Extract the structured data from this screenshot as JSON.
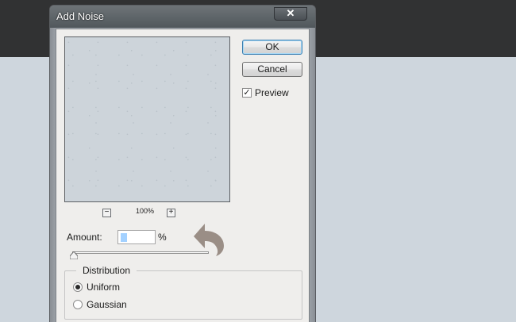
{
  "dialog": {
    "title": "Add Noise",
    "close_glyph": "✕",
    "ok_label": "OK",
    "cancel_label": "Cancel",
    "preview_label": "Preview",
    "preview_checked": true,
    "zoom_level": "100%",
    "zoom_out_glyph": "−",
    "zoom_in_glyph": "+",
    "amount_label": "Amount:",
    "amount_unit": "%",
    "amount_slider_position": 0,
    "distribution": {
      "title": "Distribution",
      "options": [
        "Uniform",
        "Gaussian"
      ],
      "selected": "Uniform"
    }
  },
  "overlay": {
    "icon": "undo-arrow-icon",
    "color": "#9a8e86"
  },
  "colors": {
    "workspace": "#ced6dd",
    "topbar": "#313233",
    "dialog_bg": "#efeeec"
  }
}
